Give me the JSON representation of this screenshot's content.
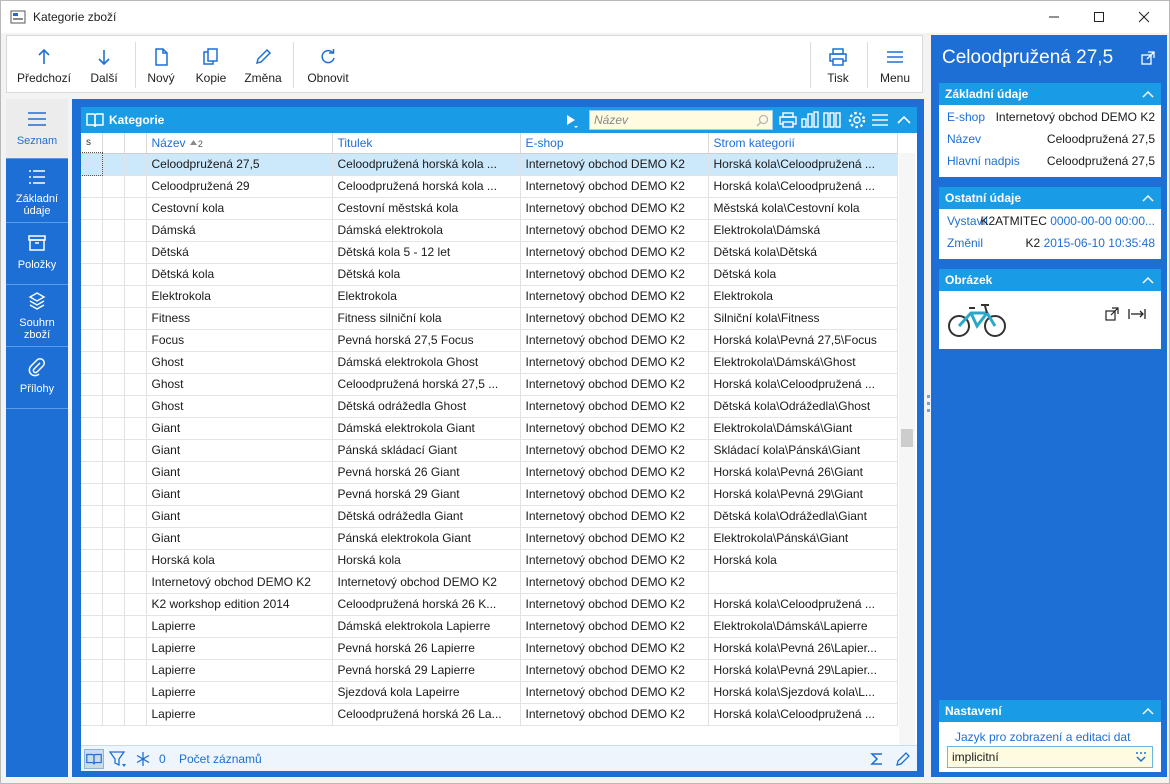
{
  "window": {
    "title": "Kategorie zboží"
  },
  "toolbar": {
    "prev": "Předchozí",
    "next": "Další",
    "new": "Nový",
    "copy": "Kopie",
    "edit": "Změna",
    "refresh": "Obnovit",
    "print": "Tisk",
    "menu": "Menu"
  },
  "leftnav": {
    "list": "Seznam",
    "basic": "Základní údaje",
    "items": "Položky",
    "summary": "Souhrn zboží",
    "attachments": "Přílohy"
  },
  "grid": {
    "title": "Kategorie",
    "search_placeholder": "Název",
    "columns": {
      "s": "s",
      "name": "Název",
      "sort_index": "2",
      "title": "Titulek",
      "eshop": "E-shop",
      "tree": "Strom kategorií"
    },
    "rows": [
      {
        "name": "Celoodpružená 27,5",
        "title": "Celoodpružená horská kola ...",
        "eshop": "Internetový obchod DEMO K2",
        "tree": "Horská kola\\Celoodpružená ..."
      },
      {
        "name": "Celoodpružená 29",
        "title": "Celoodpružená horská kola ...",
        "eshop": "Internetový obchod DEMO K2",
        "tree": "Horská kola\\Celoodpružená ..."
      },
      {
        "name": "Cestovní kola",
        "title": "Cestovní městská kola",
        "eshop": "Internetový obchod DEMO K2",
        "tree": "Městská kola\\Cestovní kola"
      },
      {
        "name": "Dámská",
        "title": "Dámská elektrokola",
        "eshop": "Internetový obchod DEMO K2",
        "tree": "Elektrokola\\Dámská"
      },
      {
        "name": "Dětská",
        "title": "Dětská kola 5 - 12 let",
        "eshop": "Internetový obchod DEMO K2",
        "tree": "Dětská kola\\Dětská"
      },
      {
        "name": "Dětská kola",
        "title": "Dětská kola",
        "eshop": "Internetový obchod DEMO K2",
        "tree": "Dětská kola"
      },
      {
        "name": "Elektrokola",
        "title": "Elektrokola",
        "eshop": "Internetový obchod DEMO K2",
        "tree": "Elektrokola"
      },
      {
        "name": "Fitness",
        "title": "Fitness silniční kola",
        "eshop": "Internetový obchod DEMO K2",
        "tree": "Silniční kola\\Fitness"
      },
      {
        "name": "Focus",
        "title": "Pevná horská 27,5 Focus",
        "eshop": "Internetový obchod DEMO K2",
        "tree": "Horská kola\\Pevná 27,5\\Focus"
      },
      {
        "name": "Ghost",
        "title": "Dámská elektrokola Ghost",
        "eshop": "Internetový obchod DEMO K2",
        "tree": "Elektrokola\\Dámská\\Ghost"
      },
      {
        "name": "Ghost",
        "title": "Celoodpružená horská 27,5 ...",
        "eshop": "Internetový obchod DEMO K2",
        "tree": "Horská kola\\Celoodpružená ..."
      },
      {
        "name": "Ghost",
        "title": "Dětská odrážedla Ghost",
        "eshop": "Internetový obchod DEMO K2",
        "tree": "Dětská kola\\Odrážedla\\Ghost"
      },
      {
        "name": "Giant",
        "title": "Dámská elektrokola Giant",
        "eshop": "Internetový obchod DEMO K2",
        "tree": "Elektrokola\\Dámská\\Giant"
      },
      {
        "name": "Giant",
        "title": "Pánská skládací Giant",
        "eshop": "Internetový obchod DEMO K2",
        "tree": "Skládací kola\\Pánská\\Giant"
      },
      {
        "name": "Giant",
        "title": "Pevná horská 26 Giant",
        "eshop": "Internetový obchod DEMO K2",
        "tree": "Horská kola\\Pevná 26\\Giant"
      },
      {
        "name": "Giant",
        "title": "Pevná horská 29 Giant",
        "eshop": "Internetový obchod DEMO K2",
        "tree": "Horská kola\\Pevná 29\\Giant"
      },
      {
        "name": "Giant",
        "title": "Dětská odrážedla Giant",
        "eshop": "Internetový obchod DEMO K2",
        "tree": "Dětská kola\\Odrážedla\\Giant"
      },
      {
        "name": "Giant",
        "title": "Pánská elektrokola Giant",
        "eshop": "Internetový obchod DEMO K2",
        "tree": "Elektrokola\\Pánská\\Giant"
      },
      {
        "name": "Horská kola",
        "title": "Horská kola",
        "eshop": "Internetový obchod DEMO K2",
        "tree": "Horská kola"
      },
      {
        "name": "Internetový obchod DEMO K2",
        "title": "Internetový obchod DEMO K2",
        "eshop": "Internetový obchod DEMO K2",
        "tree": ""
      },
      {
        "name": "K2 workshop edition 2014",
        "title": "Celoodpružená horská 26 K...",
        "eshop": "Internetový obchod DEMO K2",
        "tree": "Horská kola\\Celoodpružená ..."
      },
      {
        "name": "Lapierre",
        "title": "Dámská elektrokola Lapierre",
        "eshop": "Internetový obchod DEMO K2",
        "tree": "Elektrokola\\Dámská\\Lapierre"
      },
      {
        "name": "Lapierre",
        "title": "Pevná horská 26 Lapierre",
        "eshop": "Internetový obchod DEMO K2",
        "tree": "Horská kola\\Pevná 26\\Lapier..."
      },
      {
        "name": "Lapierre",
        "title": "Pevná horská 29 Lapierre",
        "eshop": "Internetový obchod DEMO K2",
        "tree": "Horská kola\\Pevná 29\\Lapier..."
      },
      {
        "name": "Lapierre",
        "title": "Sjezdová kola Lapeirre",
        "eshop": "Internetový obchod DEMO K2",
        "tree": "Horská kola\\Sjezdová kola\\L..."
      },
      {
        "name": "Lapierre",
        "title": "Celoodpružená horská 26 La...",
        "eshop": "Internetový obchod DEMO K2",
        "tree": "Horská kola\\Celoodpružená ..."
      }
    ],
    "footer": {
      "filter_count": "0",
      "record_count_label": "Počet záznamů"
    }
  },
  "detail": {
    "title": "Celoodpružená 27,5",
    "basic": {
      "header": "Základní údaje",
      "eshop_label": "E-shop",
      "eshop_value": "Internetový obchod DEMO K2",
      "name_label": "Název",
      "name_value": "Celoodpružená 27,5",
      "heading_label": "Hlavní nadpis",
      "heading_value": "Celoodpružená 27,5"
    },
    "other": {
      "header": "Ostatní údaje",
      "created_label": "Vystavil",
      "created_user": "K2ATMITEC",
      "created_value": "0000-00-00 00:00...",
      "changed_label": "Změnil",
      "changed_user": "K2",
      "changed_value": "2015-06-10 10:35:48"
    },
    "image": {
      "header": "Obrázek"
    },
    "settings": {
      "header": "Nastavení",
      "language_label": "Jazyk pro zobrazení a editaci dat",
      "language_value": "implicitní"
    }
  },
  "colors": {
    "accent": "#1d6fd6",
    "header": "#1a9be6",
    "selected_row": "#cce8fb",
    "input_bg": "#fffbe0"
  }
}
